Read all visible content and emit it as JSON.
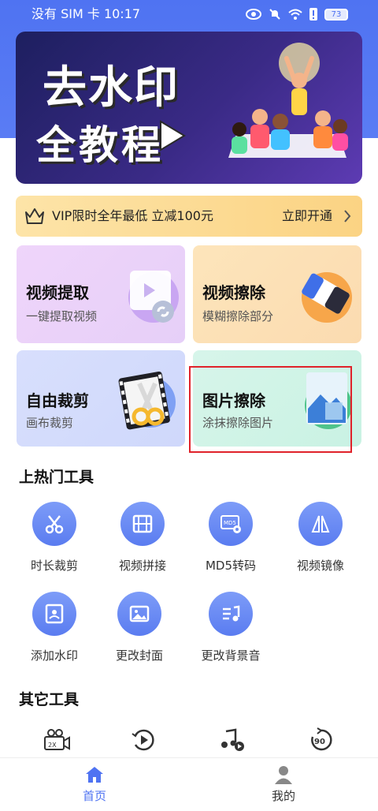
{
  "status_bar": {
    "left_text": "没有 SIM 卡 10:17",
    "battery": "73"
  },
  "banner": {
    "line1": "去水印",
    "line2": "全教程"
  },
  "vip": {
    "text": "VIP限时全年最低 立减100元",
    "action": "立即开通"
  },
  "feature_cards": [
    {
      "title": "视频提取",
      "subtitle": "一键提取视频"
    },
    {
      "title": "视频擦除",
      "subtitle": "模糊擦除部分"
    },
    {
      "title": "自由裁剪",
      "subtitle": "画布裁剪"
    },
    {
      "title": "图片擦除",
      "subtitle": "涂抹擦除图片"
    }
  ],
  "hot_tools": {
    "title": "上热门工具",
    "items": [
      {
        "label": "时长裁剪",
        "icon": "scissors-icon"
      },
      {
        "label": "视频拼接",
        "icon": "film-icon"
      },
      {
        "label": "MD5转码",
        "icon": "md5-gear-icon"
      },
      {
        "label": "视频镜像",
        "icon": "mirror-icon"
      },
      {
        "label": "添加水印",
        "icon": "watermark-icon"
      },
      {
        "label": "更改封面",
        "icon": "image-icon"
      },
      {
        "label": "更改背景音",
        "icon": "music-list-icon"
      }
    ]
  },
  "other_tools": {
    "title": "其它工具",
    "items": [
      {
        "icon": "video-speed-icon",
        "badge": "2X"
      },
      {
        "icon": "play-reverse-icon"
      },
      {
        "icon": "music-video-icon"
      },
      {
        "icon": "rotate-90-icon",
        "badge": "90"
      }
    ]
  },
  "tabbar": {
    "home": "首页",
    "mine": "我的"
  },
  "colors": {
    "primary": "#5a7cf0",
    "header_blue": "#4f73f2",
    "highlight_red": "#e0222a"
  }
}
